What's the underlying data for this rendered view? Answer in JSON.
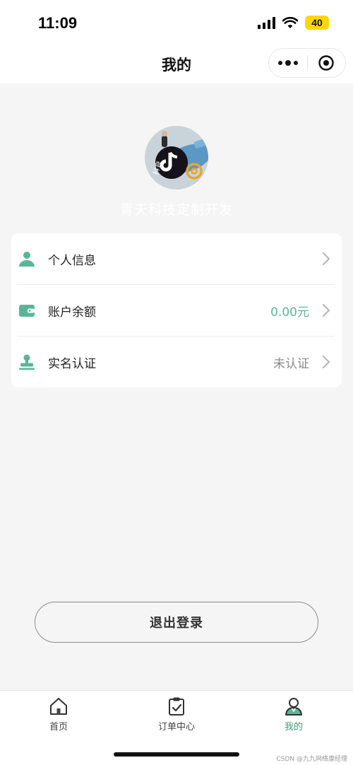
{
  "status_bar": {
    "time": "11:09",
    "battery": "40"
  },
  "nav": {
    "title": "我的"
  },
  "profile": {
    "username": "青天科技定制开发",
    "avatar_caption": "抖音"
  },
  "menu": [
    {
      "label": "个人信息",
      "value": "",
      "icon": "user-icon"
    },
    {
      "label": "账户余额",
      "value": "0.00元",
      "icon": "wallet-icon"
    },
    {
      "label": "实名认证",
      "value": "未认证",
      "icon": "stamp-icon"
    }
  ],
  "logout_label": "退出登录",
  "tabs": [
    {
      "label": "首页",
      "icon": "home-icon",
      "active": false
    },
    {
      "label": "订单中心",
      "icon": "clipboard-check-icon",
      "active": false
    },
    {
      "label": "我的",
      "icon": "person-icon",
      "active": true
    }
  ],
  "watermark": "CSDN @九九网络康经理",
  "colors": {
    "accent": "#5ab598",
    "active_tab": "#3f9b78",
    "background": "#f5f5f5",
    "battery": "#ffd60a"
  }
}
